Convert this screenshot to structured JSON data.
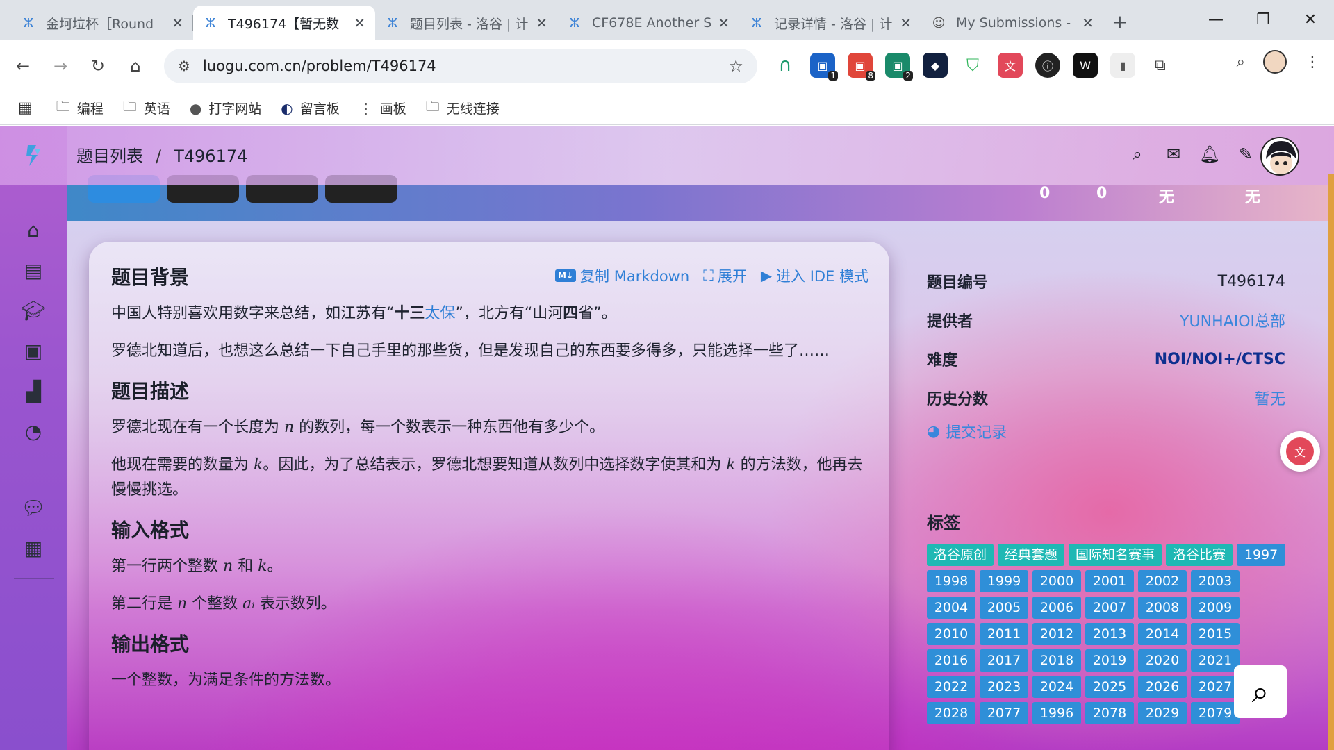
{
  "browser": {
    "tabs": [
      {
        "title": "金坷垃杯［Round",
        "active": false
      },
      {
        "title": "T496174【暂无数",
        "active": true
      },
      {
        "title": "题目列表 - 洛谷 | 计",
        "active": false
      },
      {
        "title": "CF678E Another S",
        "active": false
      },
      {
        "title": "记录详情 - 洛谷 | 计",
        "active": false
      },
      {
        "title": "My Submissions -",
        "active": false
      }
    ],
    "url": "luogu.com.cn/problem/T496174",
    "extension_badges": [
      "1",
      "8",
      "2"
    ],
    "bookmarks": [
      "编程",
      "英语",
      "打字网站",
      "留言板",
      "画板",
      "无线连接"
    ]
  },
  "header": {
    "breadcrumb_parent": "题目列表",
    "breadcrumb_sep": "/",
    "breadcrumb_current": "T496174"
  },
  "banner": {
    "stats": [
      "0",
      "0",
      "无",
      "无"
    ]
  },
  "problem": {
    "actions": {
      "copy_markdown": "复制 Markdown",
      "expand": "展开",
      "ide": "进入 IDE 模式"
    },
    "background_title": "题目背景",
    "background_p1_a": "中国人特别喜欢用数字来总结，如江苏有“",
    "background_p1_b": "十三",
    "background_p1_c": "太保",
    "background_p1_d": "”，北方有“山河",
    "background_p1_e": "四",
    "background_p1_f": "省”。",
    "background_p2": "罗德北知道后，也想这么总结一下自己手里的那些货，但是发现自己的东西要多得多，只能选择一些了……",
    "desc_title": "题目描述",
    "desc_p1_a": "罗德北现在有一个长度为 ",
    "desc_p1_b": "n",
    "desc_p1_c": " 的数列，每一个数表示一种东西他有多少个。",
    "desc_p2_a": "他现在需要的数量为 ",
    "desc_p2_b": "k",
    "desc_p2_c": "。因此，为了总结表示，罗德北想要知道从数列中选择数字使其和为 ",
    "desc_p2_d": "k",
    "desc_p2_e": " 的方法数，他再去慢慢挑选。",
    "input_title": "输入格式",
    "input_p1_a": "第一行两个整数 ",
    "input_p1_b": "n",
    "input_p1_c": " 和 ",
    "input_p1_d": "k",
    "input_p1_e": "。",
    "input_p2_a": "第二行是 ",
    "input_p2_b": "n",
    "input_p2_c": " 个整数 ",
    "input_p2_d": "aᵢ",
    "input_p2_e": " 表示数列。",
    "output_title": "输出格式",
    "output_p1": "一个整数，为满足条件的方法数。"
  },
  "info": {
    "id_label": "题目编号",
    "id_value": "T496174",
    "provider_label": "提供者",
    "provider_value": "YUNHAIOI总部",
    "difficulty_label": "难度",
    "difficulty_value": "NOI/NOI+/CTSC",
    "history_label": "历史分数",
    "history_value": "暂无",
    "submit_records": "提交记录"
  },
  "tags": {
    "title": "标签",
    "named": [
      "洛谷原创",
      "经典套题",
      "国际知名赛事",
      "洛谷比赛"
    ],
    "years": [
      "1997",
      "1998",
      "1999",
      "2000",
      "2001",
      "2002",
      "2003",
      "2004",
      "2005",
      "2006",
      "2007",
      "2008",
      "2009",
      "2010",
      "2011",
      "2012",
      "2013",
      "2014",
      "2015",
      "2016",
      "2017",
      "2018",
      "2019",
      "2020",
      "2021",
      "2022",
      "2023",
      "2024",
      "2025",
      "2026",
      "2027",
      "2028",
      "2077",
      "1996",
      "2078",
      "2029",
      "2079"
    ]
  }
}
